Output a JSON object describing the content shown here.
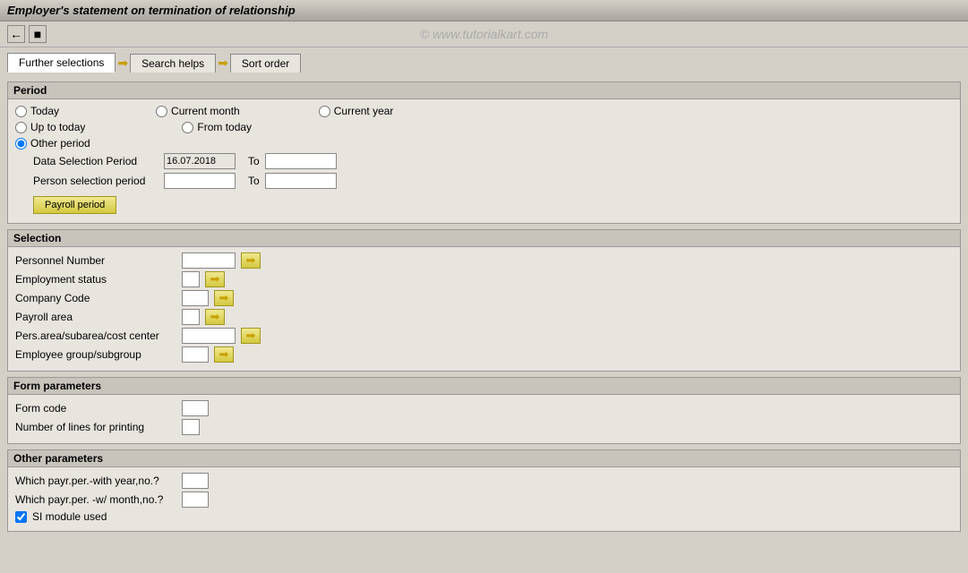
{
  "title": "Employer's statement on termination of relationship",
  "watermark": "© www.tutorialkart.com",
  "tabs": [
    {
      "label": "Further selections",
      "active": true
    },
    {
      "label": "Search helps",
      "active": false
    },
    {
      "label": "Sort order",
      "active": false
    }
  ],
  "period": {
    "header": "Period",
    "radios": [
      {
        "label": "Today",
        "name": "period",
        "value": "today"
      },
      {
        "label": "Current month",
        "name": "period",
        "value": "current_month"
      },
      {
        "label": "Current year",
        "name": "period",
        "value": "current_year"
      },
      {
        "label": "Up to today",
        "name": "period",
        "value": "up_to_today"
      },
      {
        "label": "From today",
        "name": "period",
        "value": "from_today"
      },
      {
        "label": "Other period",
        "name": "period",
        "value": "other_period",
        "checked": true
      }
    ],
    "data_selection_period_label": "Data Selection Period",
    "data_selection_period_value": "16.07.2018",
    "to_label": "To",
    "person_selection_period_label": "Person selection period",
    "payroll_period_btn": "Payroll period"
  },
  "selection": {
    "header": "Selection",
    "fields": [
      {
        "label": "Personnel Number",
        "input_class": "w60"
      },
      {
        "label": "Employment status",
        "input_class": "w20"
      },
      {
        "label": "Company Code",
        "input_class": "w30"
      },
      {
        "label": "Payroll area",
        "input_class": "w20"
      },
      {
        "label": "Pers.area/subarea/cost center",
        "input_class": "w60"
      },
      {
        "label": "Employee group/subgroup",
        "input_class": "w30"
      }
    ]
  },
  "form_parameters": {
    "header": "Form parameters",
    "fields": [
      {
        "label": "Form code",
        "input_class": "w30"
      },
      {
        "label": "Number of lines for printing",
        "input_class": "w20"
      }
    ]
  },
  "other_parameters": {
    "header": "Other parameters",
    "fields": [
      {
        "label": "Which payr.per.-with year,no.?",
        "input_class": "w30",
        "type": "input"
      },
      {
        "label": "Which payr.per. -w/ month,no.?",
        "input_class": "w30",
        "type": "input"
      }
    ],
    "checkbox_label": "SI module used"
  }
}
